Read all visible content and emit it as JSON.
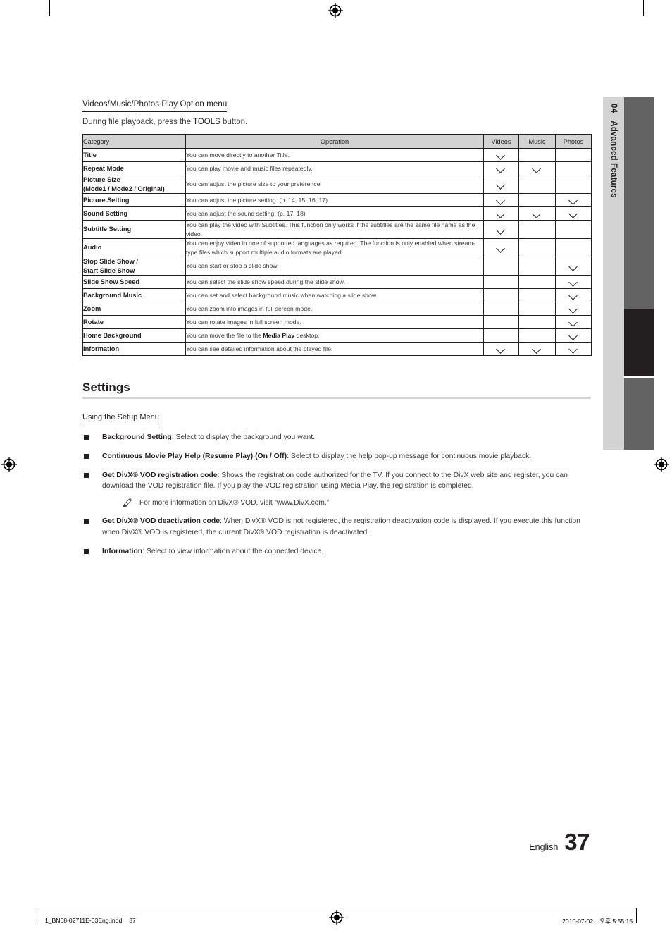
{
  "section": {
    "title": "Videos/Music/Photos Play Option menu",
    "subtitle_prefix": "During file playback, press the ",
    "subtitle_kbd": "TOOLS",
    "subtitle_suffix": " button."
  },
  "table": {
    "headers": {
      "category": "Category",
      "operation": "Operation",
      "videos": "Videos",
      "music": "Music",
      "photos": "Photos"
    },
    "rows": [
      {
        "category": "Title",
        "operation": "You can move directly to another Title.",
        "videos": true,
        "music": false,
        "photos": false
      },
      {
        "category": "Repeat Mode",
        "operation": "You can play movie and music files repeatedly.",
        "videos": true,
        "music": true,
        "photos": false
      },
      {
        "category": "Picture Size\n(Mode1 / Mode2 / Original)",
        "operation": "You can adjust the picture size to your preference.",
        "videos": true,
        "music": false,
        "photos": false
      },
      {
        "category": "Picture Setting",
        "operation": "You can adjust the picture setting. (p. 14, 15, 16, 17)",
        "videos": true,
        "music": false,
        "photos": true
      },
      {
        "category": "Sound Setting",
        "operation": "You can adjust the sound setting. (p. 17, 18)",
        "videos": true,
        "music": true,
        "photos": true
      },
      {
        "category": "Subtitle Setting",
        "operation": "You can play the video with Subtitles. This function only works if the subtitles are the same file name as the video.",
        "videos": true,
        "music": false,
        "photos": false
      },
      {
        "category": "Audio",
        "operation": "You can enjoy video in one of supported languages as required. The function is only enabled when stream-type files which support multiple audio formats are played.",
        "videos": true,
        "music": false,
        "photos": false
      },
      {
        "category": "Stop Slide Show /\nStart Slide Show",
        "operation": "You can start or stop a slide show.",
        "videos": false,
        "music": false,
        "photos": true
      },
      {
        "category": "Slide Show Speed",
        "operation": "You can select the slide show speed during the slide show.",
        "videos": false,
        "music": false,
        "photos": true
      },
      {
        "category": "Background Music",
        "operation": "You can set and select background music when watching a slide show.",
        "videos": false,
        "music": false,
        "photos": true
      },
      {
        "category": "Zoom",
        "operation": "You can zoom into images in full screen mode.",
        "videos": false,
        "music": false,
        "photos": true
      },
      {
        "category": "Rotate",
        "operation": "You can rotate images in full screen mode.",
        "videos": false,
        "music": false,
        "photos": true
      },
      {
        "category": "Home Background",
        "operation_pre": "You can move the file to the ",
        "operation_bold": "Media Play",
        "operation_post": " desktop.",
        "videos": false,
        "music": false,
        "photos": true
      },
      {
        "category": "Information",
        "operation": "You can see detailed information about the played file.",
        "videos": true,
        "music": true,
        "photos": true
      }
    ]
  },
  "settings": {
    "heading": "Settings",
    "subheading": "Using the Setup Menu",
    "bullets": [
      {
        "term": "Background Setting",
        "desc": ": Select to display the background you want."
      },
      {
        "term": "Continuous Movie Play Help (Resume Play) (On / Off)",
        "desc": ": Select to display the help pop-up message for continuous movie playback."
      },
      {
        "term": "Get DivX® VOD registration code",
        "desc": ": Shows the registration code authorized for the TV. If you connect to the DivX web site and register, you can download the VOD registration file. If you play the VOD registration using Media Play, the registration is completed.",
        "note": "For more information on DivX® VOD, visit “www.DivX.com.”"
      },
      {
        "term": "Get DivX® VOD deactivation code",
        "desc": ": When DivX® VOD is not registered, the registration deactivation code is displayed. If you execute this function when DivX® VOD is registered, the current DivX® VOD registration is deactivated."
      },
      {
        "term": "Information",
        "desc": ": Select to view information about the connected device."
      }
    ]
  },
  "side_tab": {
    "number": "04",
    "label": "Advanced Features"
  },
  "page_footer": {
    "language": "English",
    "page_number": "37"
  },
  "print_strip": {
    "filename": "1_BN68-02711E-03Eng.indd",
    "page": "37",
    "date": "2010-07-02",
    "time": "오후 5:55:15"
  },
  "colors": {
    "header_fill": "#d3d3d3",
    "tab_dark": "#636363",
    "tab_black": "#231f20",
    "rule": "#d3d3d3"
  }
}
